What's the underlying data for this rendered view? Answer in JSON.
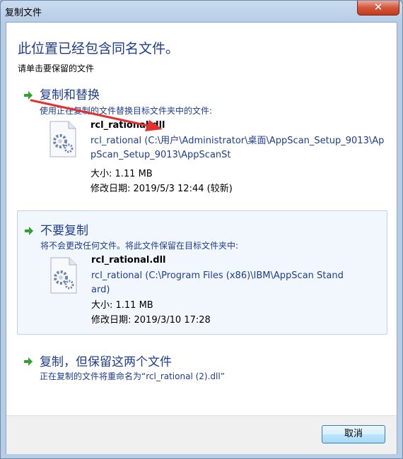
{
  "window": {
    "title": "复制文件",
    "close_label": "✕"
  },
  "header": {
    "heading": "此位置已经包含同名文件。",
    "subheading": "请单击要保留的文件"
  },
  "options": [
    {
      "title": "复制和替换",
      "description": "使用正在复制的文件替换目标文件夹中的文件:",
      "file": {
        "name": "rcl_rational.dll",
        "path": "rcl_rational (C:\\用户\\Administrator\\桌面\\AppScan_Setup_9013\\AppScan_Setup_9013\\AppScanSt",
        "size": "大小: 1.11 MB",
        "modified": "修改日期: 2019/5/3 12:44 (较新)"
      }
    },
    {
      "title": "不要复制",
      "description": "将不会更改任何文件。将此文件保留在目标文件夹中:",
      "file": {
        "name": "rcl_rational.dll",
        "path": "rcl_rational (C:\\Program Files (x86)\\IBM\\AppScan Standard)",
        "size": "大小: 1.11 MB",
        "modified": "修改日期: 2019/3/10 17:28"
      }
    },
    {
      "title": "复制，但保留这两个文件",
      "description": "正在复制的文件将重命名为“rcl_rational (2).dll”"
    }
  ],
  "footer": {
    "cancel_label": "取消"
  },
  "colors": {
    "link_blue": "#1e3d8f",
    "arrow_green": "#2fa32b",
    "annotation_red": "#e53030"
  },
  "icons": [
    "close-icon",
    "green-arrow-icon",
    "dll-file-icon"
  ]
}
